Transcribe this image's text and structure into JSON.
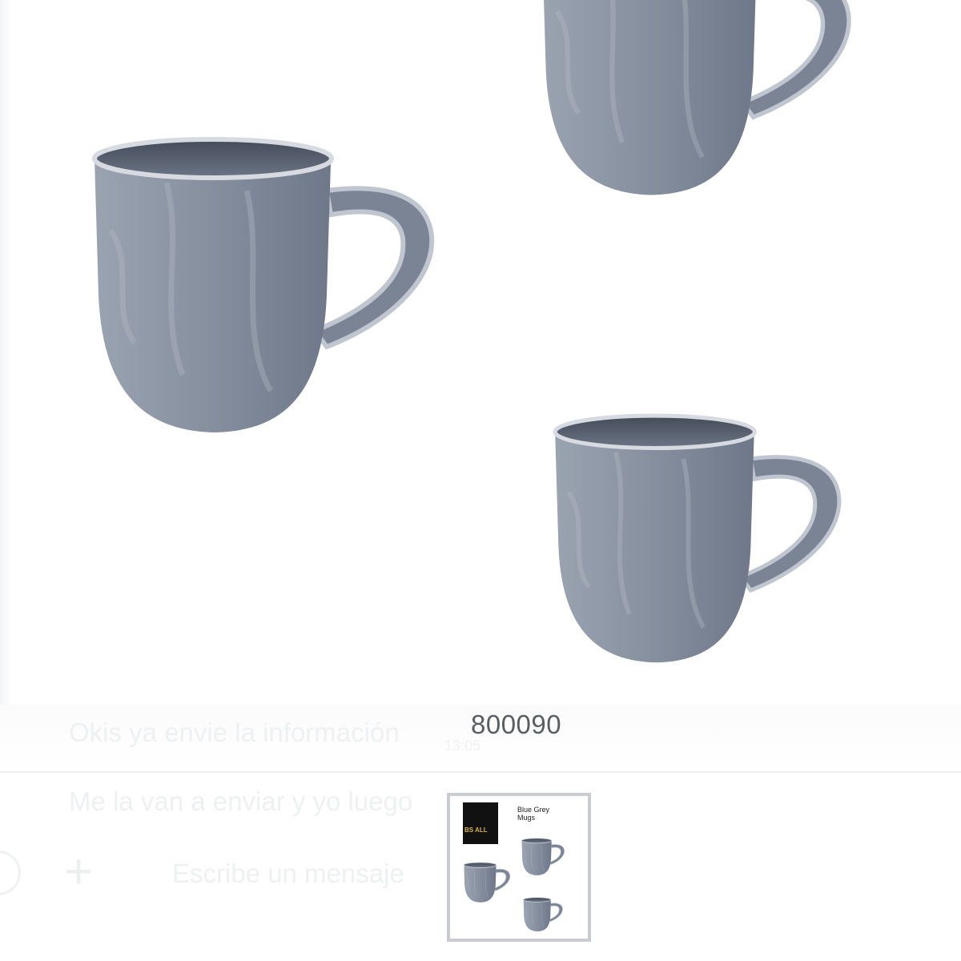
{
  "preview": {
    "caption": "800090"
  },
  "chat_background": {
    "message_1": "Okis ya envie la información",
    "message_1_time": "13:05",
    "message_2": "Me la van a enviar y yo luego",
    "input_placeholder": "Escribe un mensaje",
    "add_icon": "plus-icon",
    "emoji_icon": "emoji-icon"
  },
  "thumbnail": {
    "logo_text": "BS ALL",
    "title": "Blue Grey Mugs"
  },
  "colors": {
    "mug_glaze": "#7f8a99",
    "mug_dark": "#4e5665",
    "caption": "#5a5e63",
    "thumb_border": "#c9ccd0"
  }
}
